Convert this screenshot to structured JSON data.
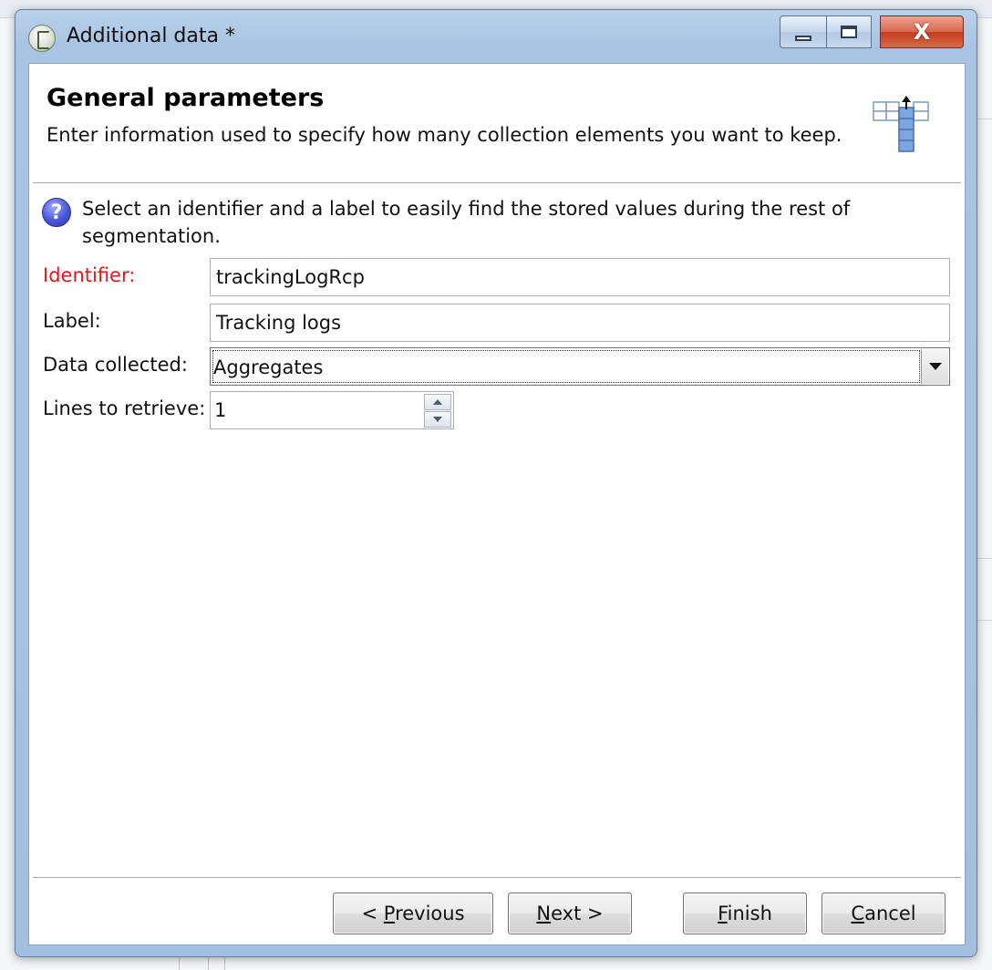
{
  "window": {
    "title": "Additional data *",
    "close_glyph": "X"
  },
  "header": {
    "title": "General parameters",
    "subtitle": "Enter information used to specify how many collection elements you want to keep.",
    "icon": "table-column-icon"
  },
  "help": {
    "icon_glyph": "?",
    "text": "Select an identifier and a label to easily find the stored values during the rest of segmentation."
  },
  "form": {
    "identifier": {
      "label": "Identifier:",
      "value": "trackingLogRcp"
    },
    "label_field": {
      "label": "Label:",
      "value": "Tracking logs"
    },
    "data_collected": {
      "label": "Data collected:",
      "selected": "Aggregates"
    },
    "lines_to_retrieve": {
      "label": "Lines to retrieve:",
      "value": "1"
    }
  },
  "buttons": {
    "previous": {
      "pre": "< ",
      "mnemonic": "P",
      "post": "revious"
    },
    "next": {
      "pre": "",
      "mnemonic": "N",
      "post": "ext >"
    },
    "finish": {
      "pre": "",
      "mnemonic": "F",
      "post": "inish"
    },
    "cancel": {
      "pre": "",
      "mnemonic": "C",
      "post": "ancel"
    }
  },
  "colors": {
    "required_label": "#e01b1b",
    "close_button": "#c23d1f",
    "help_icon": "#4a56d8"
  }
}
